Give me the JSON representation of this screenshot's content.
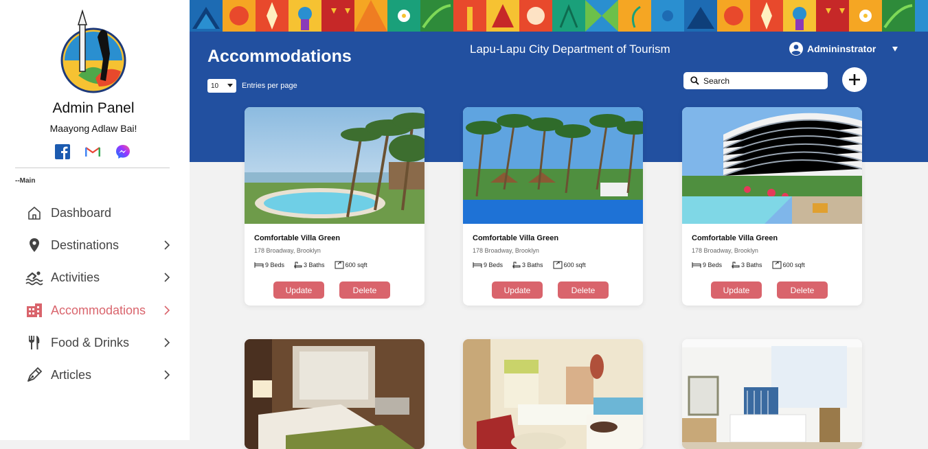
{
  "sidebar": {
    "title": "Admin Panel",
    "greeting": "Maayong Adlaw Bai!",
    "section_label": "--Main",
    "items": [
      {
        "label": "Dashboard",
        "icon": "home-icon"
      },
      {
        "label": "Destinations",
        "icon": "location-pin-icon"
      },
      {
        "label": "Activities",
        "icon": "swimming-icon"
      },
      {
        "label": "Accommodations",
        "icon": "building-icon",
        "active": true
      },
      {
        "label": "Food & Drinks",
        "icon": "fork-knife-icon"
      },
      {
        "label": "Articles",
        "icon": "pen-icon"
      }
    ],
    "socials": [
      "facebook-icon",
      "gmail-icon",
      "messenger-icon"
    ]
  },
  "header": {
    "page_title": "Accommodations",
    "department": "Lapu-Lapu City Department of Tourism",
    "user_name": "Admininstrator",
    "entries_value": "10",
    "entries_label": "Entries per page",
    "search_placeholder": "Search"
  },
  "cards": [
    {
      "name": "Comfortable Villa Green",
      "address": "178 Broadway, Brooklyn",
      "beds": "9 Beds",
      "baths": "3 Baths",
      "area": "600 sqft",
      "update": "Update",
      "delete": "Delete"
    },
    {
      "name": "Comfortable Villa Green",
      "address": "178 Broadway, Brooklyn",
      "beds": "9 Beds",
      "baths": "3 Baths",
      "area": "600 sqft",
      "update": "Update",
      "delete": "Delete"
    },
    {
      "name": "Comfortable Villa Green",
      "address": "178 Broadway, Brooklyn",
      "beds": "9 Beds",
      "baths": "3 Baths",
      "area": "600 sqft",
      "update": "Update",
      "delete": "Delete"
    }
  ],
  "colors": {
    "accent": "#d9646c",
    "header": "#2250a0",
    "sidebar": "#ffffff"
  }
}
